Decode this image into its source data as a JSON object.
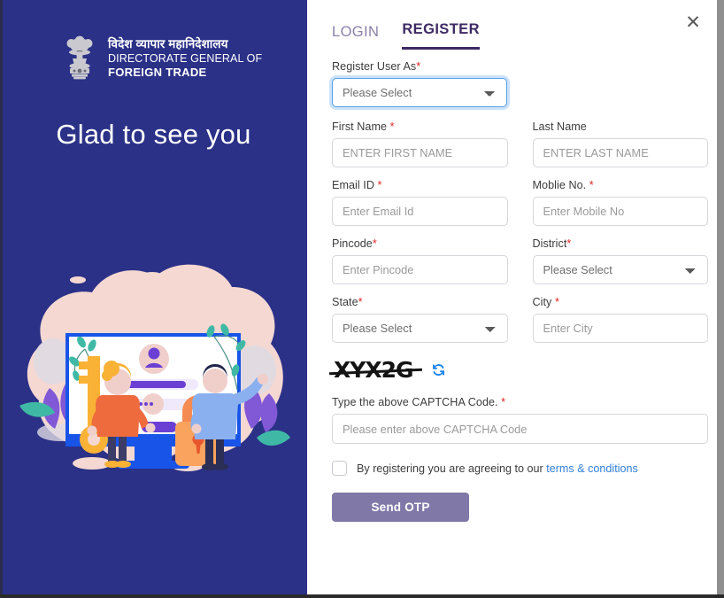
{
  "brand": {
    "hindi": "विदेश व्यापार महानिदेशालय",
    "line1": "DIRECTORATE GENERAL OF",
    "line2": "FOREIGN TRADE",
    "emblem_icon": "india-national-emblem-icon"
  },
  "hero": {
    "headline": "Glad to see you",
    "illustration_icon": "login-security-illustration"
  },
  "close": {
    "label": "✕",
    "icon": "close-icon"
  },
  "tabs": [
    {
      "label": "LOGIN",
      "active": false
    },
    {
      "label": "REGISTER",
      "active": true
    }
  ],
  "form": {
    "user_type": {
      "label": "Register User As",
      "required": true,
      "value": "Please Select",
      "options": [
        "Please Select"
      ]
    },
    "first_name": {
      "label": "First Name ",
      "required": true,
      "placeholder": "ENTER FIRST NAME",
      "value": ""
    },
    "last_name": {
      "label": "Last Name",
      "required": false,
      "placeholder": "ENTER LAST NAME",
      "value": ""
    },
    "email": {
      "label": "Email ID ",
      "required": true,
      "placeholder": "Enter Email Id",
      "value": ""
    },
    "mobile": {
      "label": "Moblie No. ",
      "required": true,
      "placeholder": "Enter Mobile No",
      "value": ""
    },
    "pincode": {
      "label": "Pincode",
      "required": true,
      "placeholder": "Enter Pincode",
      "value": ""
    },
    "district": {
      "label": "District",
      "required": true,
      "value": "Please Select",
      "options": [
        "Please Select"
      ]
    },
    "state": {
      "label": "State",
      "required": true,
      "value": "Please Select",
      "options": [
        "Please Select"
      ]
    },
    "city": {
      "label": "City ",
      "required": true,
      "placeholder": "Enter City",
      "value": ""
    },
    "captcha": {
      "code_image_text": "XYX2G",
      "refresh_icon": "refresh-icon",
      "label": "Type the above CAPTCHA Code. ",
      "required": true,
      "placeholder": "Please enter above CAPTCHA Code",
      "value": ""
    },
    "terms": {
      "checked": false,
      "text": "By registering you are agreeing to our",
      "link_text": "terms & conditions"
    },
    "submit": {
      "label": "Send OTP",
      "disabled": true
    }
  },
  "colors": {
    "panel_blue": "#2b3187",
    "tab_active": "#3e2a63",
    "tab_inactive": "#8b7fa8",
    "required_red": "#e02020",
    "link_blue": "#2f7fd6",
    "button_purple": "#8079a8",
    "focus_blue": "#56a0e8"
  }
}
